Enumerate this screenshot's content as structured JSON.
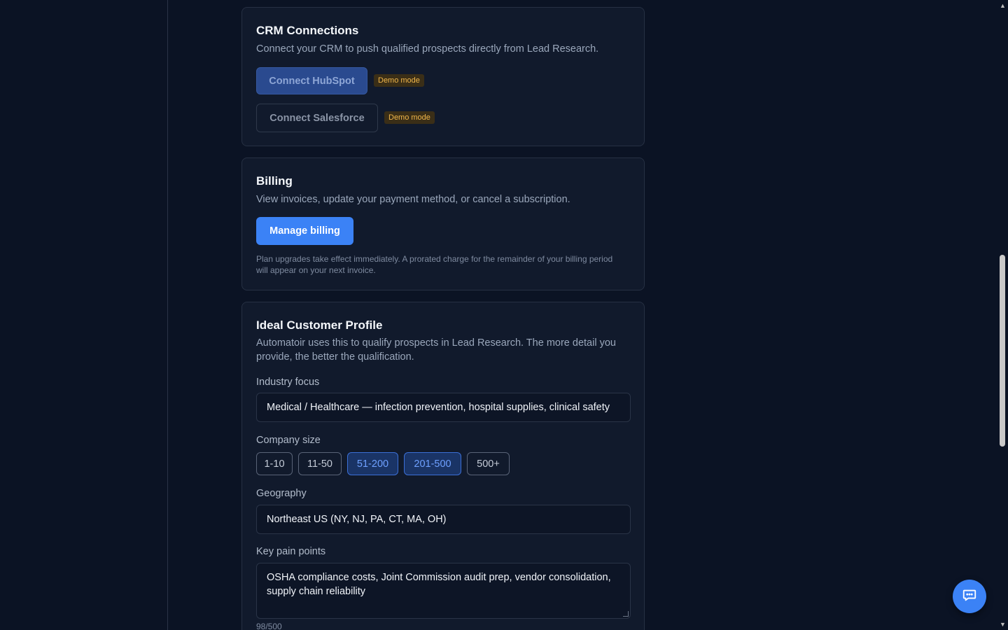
{
  "crm": {
    "title": "CRM Connections",
    "description": "Connect your CRM to push qualified prospects directly from Lead Research.",
    "hubspot_label": "Connect HubSpot",
    "salesforce_label": "Connect Salesforce",
    "demo_badge": "Demo mode"
  },
  "billing": {
    "title": "Billing",
    "description": "View invoices, update your payment method, or cancel a subscription.",
    "button_label": "Manage billing",
    "note": "Plan upgrades take effect immediately. A prorated charge for the remainder of your billing period will appear on your next invoice."
  },
  "icp": {
    "title": "Ideal Customer Profile",
    "description": "Automatoir uses this to qualify prospects in Lead Research. The more detail you provide, the better the qualification.",
    "industry_label": "Industry focus",
    "industry_value": "Medical / Healthcare — infection prevention, hospital supplies, clinical safety",
    "company_size_label": "Company size",
    "company_sizes": [
      {
        "label": "1-10",
        "selected": false
      },
      {
        "label": "11-50",
        "selected": false
      },
      {
        "label": "51-200",
        "selected": true
      },
      {
        "label": "201-500",
        "selected": true
      },
      {
        "label": "500+",
        "selected": false
      }
    ],
    "geography_label": "Geography",
    "geography_value": "Northeast US (NY, NJ, PA, CT, MA, OH)",
    "pain_points_label": "Key pain points",
    "pain_points_value": "OSHA compliance costs, Joint Commission audit prep, vendor consolidation, supply chain reliability",
    "pain_points_counter": "98/500"
  },
  "colors": {
    "background": "#0b1324",
    "card": "#111a2c",
    "accent": "#3b82f6",
    "badge_text": "#f0b64a"
  },
  "icons": {
    "chat": "chat-bubble-icon"
  }
}
